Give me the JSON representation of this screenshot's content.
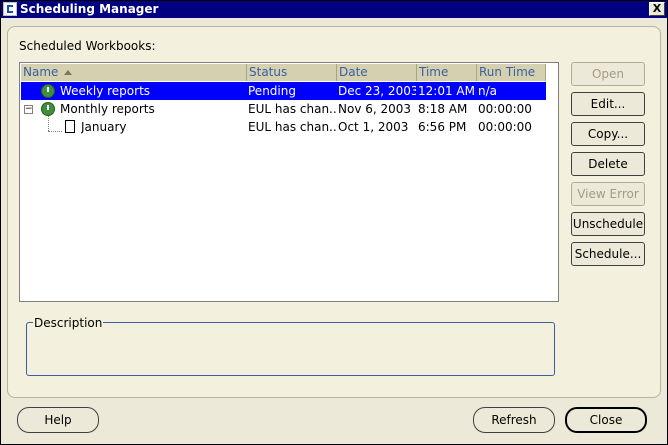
{
  "window": {
    "title": "Scheduling Manager",
    "close_glyph": "X"
  },
  "labels": {
    "scheduled_workbooks": "Scheduled Workbooks:",
    "description": "Description"
  },
  "columns": [
    {
      "label": "Name"
    },
    {
      "label": "Status"
    },
    {
      "label": "Date"
    },
    {
      "label": "Time"
    },
    {
      "label": "Run Time"
    }
  ],
  "rows": [
    {
      "name": "Weekly reports",
      "status": "Pending",
      "date": "Dec 23, 2003",
      "time": "12:01 AM",
      "run_time": "n/a",
      "selected": true
    },
    {
      "name": "Monthly reports",
      "status": "EUL has chan...",
      "date": "Nov 6, 2003",
      "time": "8:18 AM",
      "run_time": "00:00:00",
      "expanded": true
    },
    {
      "name": "January",
      "status": "EUL has chan...",
      "date": "Oct 1, 2003",
      "time": "6:56 PM",
      "run_time": "00:00:00"
    }
  ],
  "side_buttons": {
    "open": "Open",
    "edit": "Edit...",
    "copy": "Copy...",
    "delete": "Delete",
    "view_error": "View Error",
    "unschedule": "Unschedule",
    "schedule": "Schedule..."
  },
  "bottom_buttons": {
    "help": "Help",
    "refresh": "Refresh",
    "close": "Close"
  },
  "colors": {
    "title_bar": "#000080",
    "selection": "#0000ff",
    "header_text": "#3a5fa0",
    "accent_border": "#3a5fa0"
  }
}
